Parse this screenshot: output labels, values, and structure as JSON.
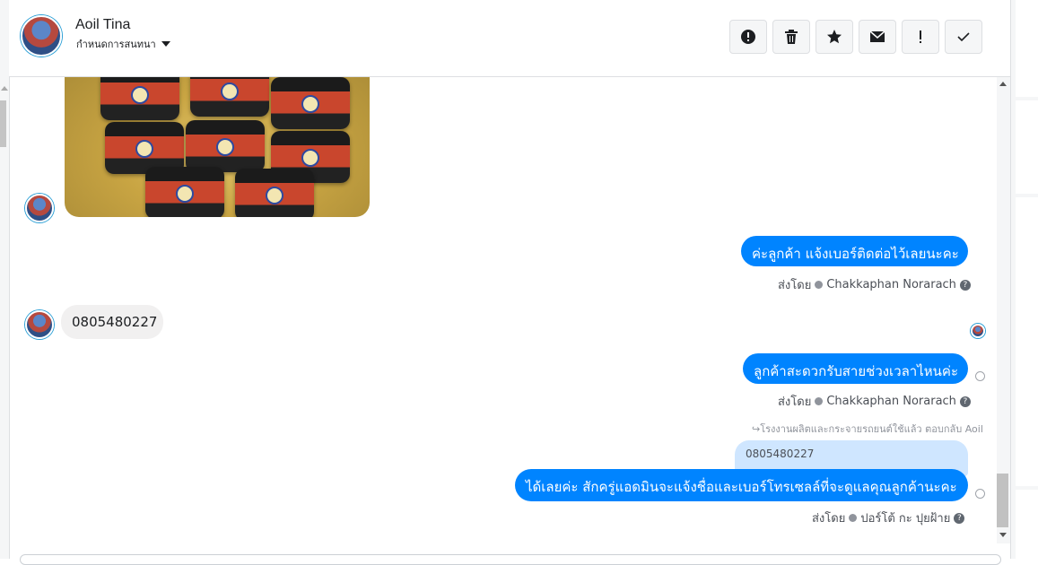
{
  "header": {
    "contact_name": "Aoil Tina",
    "conversation_action": "กำหนดการสนทนา",
    "toolbar": [
      {
        "name": "alert-circle",
        "label": "Mark as spam"
      },
      {
        "name": "trash",
        "label": "Delete"
      },
      {
        "name": "star",
        "label": "Star"
      },
      {
        "name": "envelope",
        "label": "Mark as unread"
      },
      {
        "name": "exclamation",
        "label": "Follow up"
      },
      {
        "name": "checkmark",
        "label": "Done"
      }
    ]
  },
  "messages": {
    "m1": {
      "direction": "outgoing",
      "text": "ค่ะลูกค้า แจ้งเบอร์ติดต่อไว้เลยนะคะ",
      "sent_by_label": "ส่งโดย",
      "agent": "Chakkaphan Norarach"
    },
    "m2": {
      "direction": "incoming",
      "text": "0805480227"
    },
    "m3": {
      "direction": "outgoing",
      "text": "ลูกค้าสะดวกรับสายช่วงเวลาไหนค่ะ",
      "sent_by_label": "ส่งโดย",
      "agent": "Chakkaphan Norarach"
    },
    "m4": {
      "direction": "outgoing",
      "reply_meta": "โรงงานผลิตและกระจายรถยนต์ใช้แล้ว ตอบกลับ Aoil",
      "quoted_text": "0805480227",
      "text": "ได้เลยค่ะ สักครู่แอดมินจะแจ้งชื่อและเบอร์โทรเซลล์ที่จะดูแลคุณลูกค้านะคะ",
      "sent_by_label": "ส่งโดย",
      "agent": "ปอร์โต้ กะ ปุยฝ้าย"
    }
  },
  "icons": {
    "help": "question-circle-icon",
    "sent_check": "check-circle-icon",
    "reply": "reply-arrow-icon"
  },
  "colors": {
    "outgoing_bubble": "#0084ff",
    "incoming_bubble": "#f1f0f0",
    "quoted_bubble": "#cfe6ff"
  }
}
